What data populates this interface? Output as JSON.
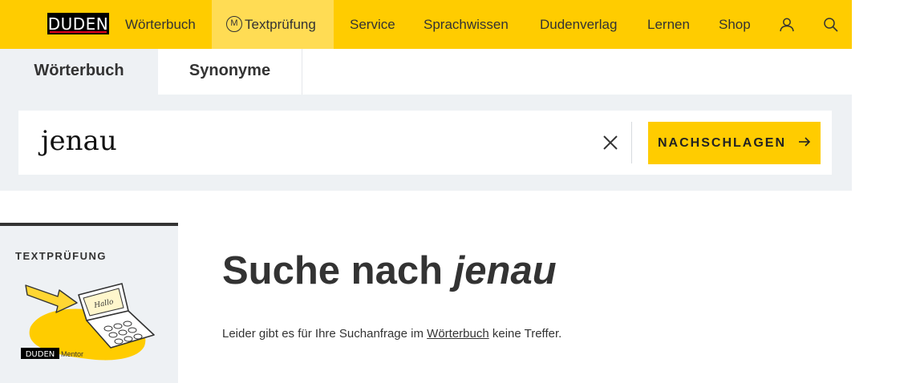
{
  "nav": {
    "logo": "DUDEN",
    "items": [
      "Wörterbuch",
      "Textprüfung",
      "Service",
      "Sprachwissen",
      "Dudenverlag",
      "Lernen",
      "Shop"
    ],
    "mentor_badge": "M"
  },
  "tabs": [
    "Wörterbuch",
    "Synonyme"
  ],
  "search": {
    "value": "jenau",
    "button_label": "NACHSCHLAGEN"
  },
  "promo": {
    "title": "TEXTPRÜFUNG",
    "logo_duden": "DUDEN",
    "logo_mentor": "Mentor",
    "screen_text": "Hallo"
  },
  "result": {
    "heading_prefix": "Suche nach",
    "query": "jenau",
    "text_before": "Leider gibt es für Ihre Suchanfrage im",
    "link": "Wörterbuch",
    "text_after": "keine Treffer."
  },
  "colors": {
    "brand_yellow": "#ffcc00",
    "active_nav": "#ffdc54",
    "panel_gray": "#eef1f4"
  }
}
